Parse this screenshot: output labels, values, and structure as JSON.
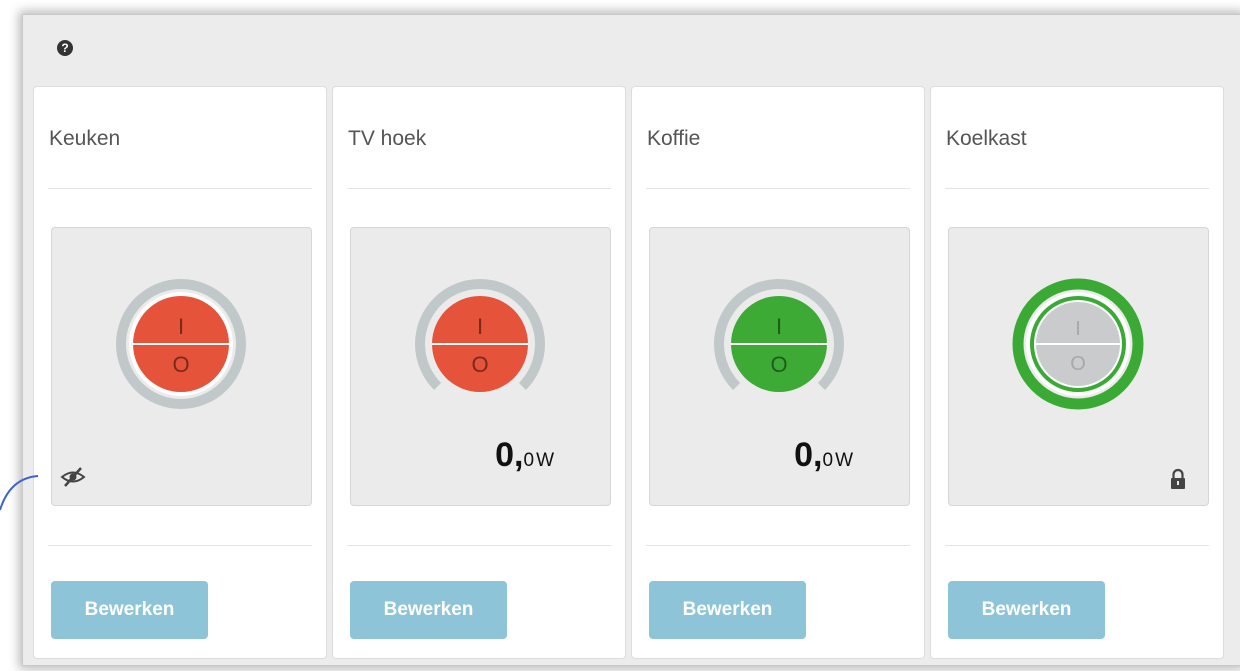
{
  "help": {
    "icon": "help-circle-icon",
    "glyph": "?"
  },
  "cards": [
    {
      "title": "Keuken",
      "state": "off",
      "color": "#e5533a",
      "ring": "full",
      "on_symbol": "I",
      "off_symbol": "O",
      "badge_icon": "hidden-eye-icon",
      "edit_label": "Bewerken"
    },
    {
      "title": "TV hoek",
      "state": "off",
      "color": "#e5533a",
      "ring": "gauge",
      "on_symbol": "I",
      "off_symbol": "O",
      "power": {
        "int": "0,",
        "dec": "0",
        "unit": "W"
      },
      "edit_label": "Bewerken"
    },
    {
      "title": "Koffie",
      "state": "on",
      "color": "#3daa35",
      "ring": "gauge",
      "on_symbol": "I",
      "off_symbol": "O",
      "power": {
        "int": "0,",
        "dec": "0",
        "unit": "W"
      },
      "edit_label": "Bewerken"
    },
    {
      "title": "Koelkast",
      "state": "locked-on",
      "color": "#c9cbcc",
      "ring_color": "#3aaa35",
      "ring": "full",
      "on_symbol": "I",
      "off_symbol": "O",
      "badge_icon": "lock-icon",
      "edit_label": "Bewerken"
    }
  ]
}
